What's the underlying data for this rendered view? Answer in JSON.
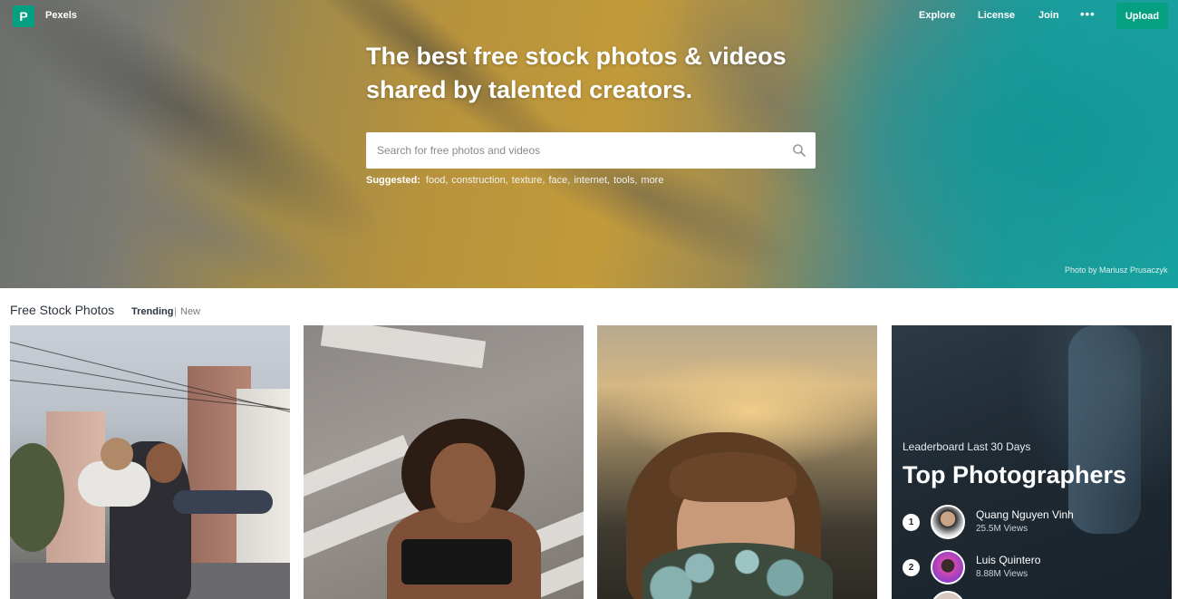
{
  "nav": {
    "brand": "Pexels",
    "logo_letter": "P",
    "links": [
      "Explore",
      "License",
      "Join"
    ],
    "more_glyph": "•••",
    "upload_label": "Upload",
    "accent_color": "#05a081"
  },
  "hero": {
    "headline": "The best free stock photos & videos shared by talented creators.",
    "search": {
      "placeholder": "Search for free photos and videos",
      "value": ""
    },
    "suggested_label": "Suggested:",
    "suggested_tags": [
      "food",
      "construction",
      "texture",
      "face",
      "internet",
      "tools",
      "more"
    ],
    "credit": "Photo by Mariusz Prusaczyk"
  },
  "section": {
    "title": "Free Stock Photos",
    "tab_active": "Trending",
    "tab_separator": "|",
    "tab_other": "New"
  },
  "leaderboard": {
    "subtitle": "Leaderboard Last 30 Days",
    "title": "Top Photographers",
    "entries": [
      {
        "rank": "1",
        "name": "Quang Nguyen Vinh",
        "views": "25.5M Views"
      },
      {
        "rank": "2",
        "name": "Luis Quintero",
        "views": "8.88M Views"
      }
    ]
  }
}
